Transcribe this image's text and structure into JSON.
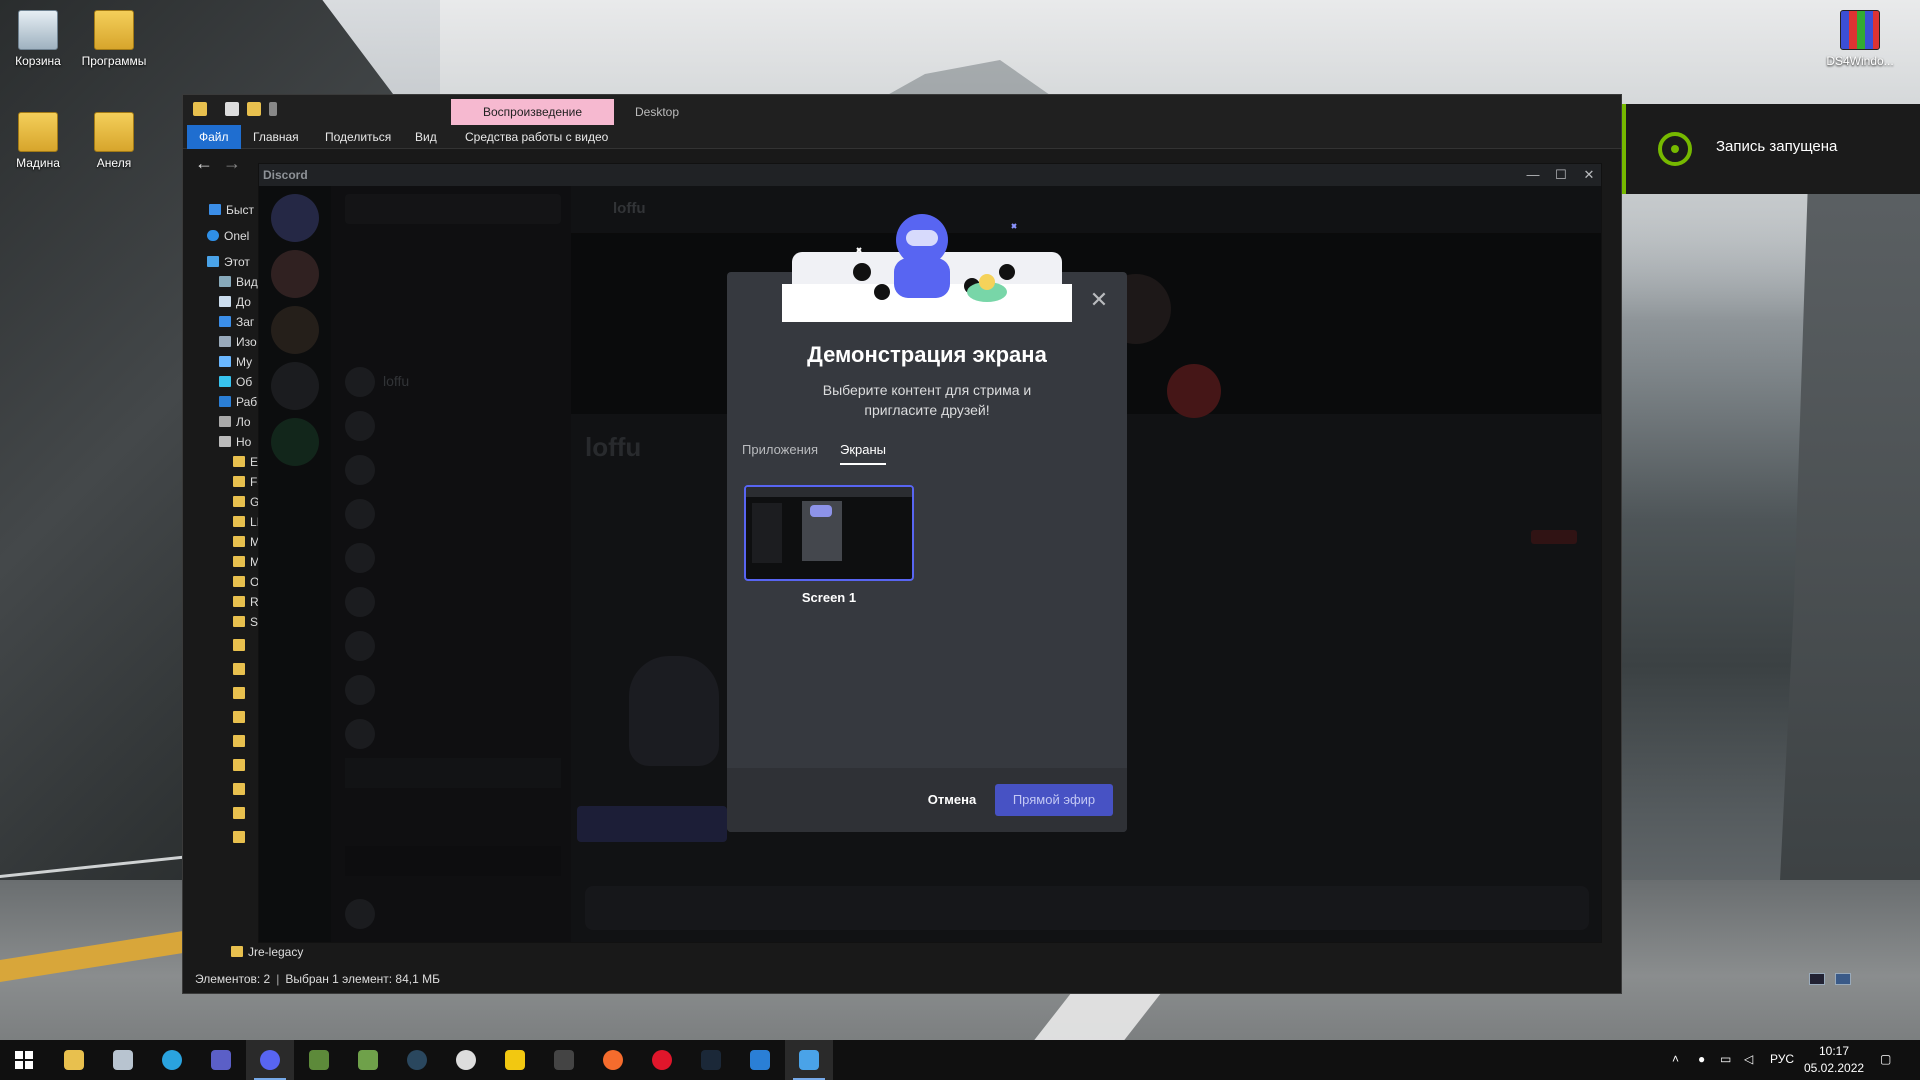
{
  "desktop": {
    "icons": [
      {
        "label": "Корзина",
        "kind": "bin"
      },
      {
        "label": "Программы",
        "kind": "folder"
      },
      {
        "label": "Мадина",
        "kind": "folder"
      },
      {
        "label": "Анеля",
        "kind": "folder"
      },
      {
        "label": "DS4Windo...",
        "kind": "zip"
      }
    ]
  },
  "explorer": {
    "tab_active": "Воспроизведение",
    "tab_title": "Desktop",
    "ribbon": [
      "Файл",
      "Главная",
      "Поделиться",
      "Вид",
      "Средства работы с видео"
    ],
    "sidebar": [
      "Быст",
      "Onel",
      "Этот",
      "Вид",
      "До",
      "Заг",
      "Изо",
      "Му",
      "Об",
      "Раб",
      "Ло",
      "Но"
    ],
    "folder_rows": [
      "Ep",
      "Fa",
      "G",
      "LI",
      "M",
      "M",
      "O",
      "R",
      "Sl"
    ],
    "bottom_folder": "Jre-legacy",
    "status": {
      "count": "Элементов: 2",
      "selected": "Выбран 1 элемент: 84,1 МБ"
    }
  },
  "discord": {
    "app_title": "Discord",
    "channel_name": "loffu",
    "call_avatar_count": 2,
    "modal": {
      "title": "Демонстрация экрана",
      "subtitle": "Выберите контент для стрима и пригласите друзей!",
      "tabs": [
        "Приложения",
        "Экраны"
      ],
      "active_tab": "Экраны",
      "screens": [
        {
          "label": "Screen 1"
        }
      ],
      "cancel": "Отмена",
      "go_live": "Прямой эфир",
      "close": "✕",
      "accent": "#5865f2"
    }
  },
  "notification": {
    "text": "Запись запущена",
    "accent": "#76b900"
  },
  "taskbar": {
    "apps": [
      "start",
      "file-explorer",
      "mail",
      "telegram",
      "teams",
      "discord",
      "minecraft",
      "minecraft-launcher",
      "steam",
      "browser",
      "game-launcher",
      "epic-games",
      "origin",
      "opera",
      "steam-alt",
      "g-app",
      "video-app"
    ],
    "tray": {
      "lang": "РУС",
      "time": "10:17",
      "date": "05.02.2022"
    }
  }
}
